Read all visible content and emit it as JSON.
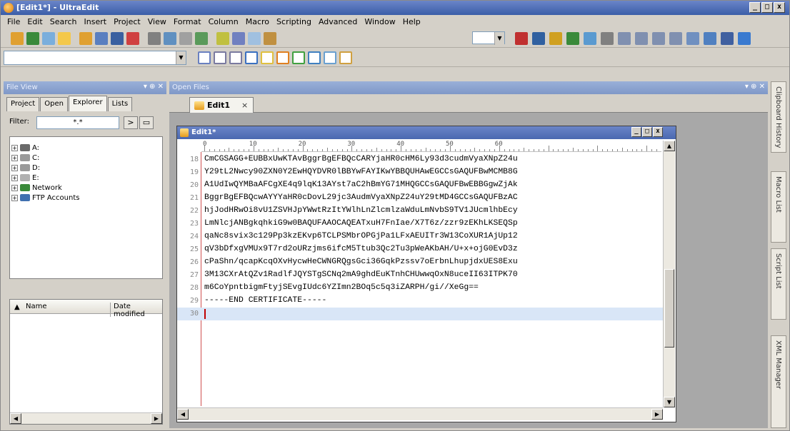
{
  "window": {
    "title": "[Edit1*] - UltraEdit"
  },
  "menu": [
    "File",
    "Edit",
    "Search",
    "Insert",
    "Project",
    "View",
    "Format",
    "Column",
    "Macro",
    "Scripting",
    "Advanced",
    "Window",
    "Help"
  ],
  "left_panel": {
    "title": "File View",
    "tabs": [
      "Project",
      "Open",
      "Explorer",
      "Lists"
    ],
    "active_tab": "Explorer",
    "filter_label": "Filter:",
    "filter_value": "*.*",
    "tree": [
      {
        "label": "A:",
        "icon": "floppy-drive-icon"
      },
      {
        "label": "C:",
        "icon": "hard-drive-icon"
      },
      {
        "label": "D:",
        "icon": "hard-drive-icon"
      },
      {
        "label": "E:",
        "icon": "cd-drive-icon"
      },
      {
        "label": "Network",
        "icon": "network-icon"
      },
      {
        "label": "FTP Accounts",
        "icon": "ftp-accounts-icon"
      }
    ],
    "list_headers": [
      "Name",
      "Date modified"
    ]
  },
  "open_files": {
    "title": "Open Files",
    "tab_label": "Edit1",
    "tab_close": "×"
  },
  "editor": {
    "title": "Edit1*",
    "ruler_marks": [
      "0",
      "10",
      "20",
      "30",
      "40",
      "50",
      "60"
    ],
    "lines": [
      {
        "n": "18",
        "text": "CmCGSAGG+EUBBxUwKTAvBggrBgEFBQcCARYjaHR0cHM6Ly93d3cudmVyaXNpZ24u"
      },
      {
        "n": "19",
        "text": "Y29tL2Nwcy90ZXN0Y2EwHQYDVR0lBBYwFAYIKwYBBQUHAwEGCCsGAQUFBwMCMB8G"
      },
      {
        "n": "20",
        "text": "A1UdIwQYMBaAFCgXE4q9lqK13AYst7aC2hBmYG71MHQGCCsGAQUFBwEBBGgwZjAk"
      },
      {
        "n": "21",
        "text": "BggrBgEFBQcwAYYYaHR0cDovL29jc3AudmVyaXNpZ24uY29tMD4GCCsGAQUFBzAC"
      },
      {
        "n": "22",
        "text": "hjJodHRwOi8vU1ZSVHJpYWwtRzItYWlhLnZlcmlzaWduLmNvbS9TV1JUcmlhbEcy"
      },
      {
        "n": "23",
        "text": "LmNlcjANBgkqhkiG9w0BAQUFAAOCAQEATxuH7FnIae/X7T6z/zzr9zEKhLKSEQSp"
      },
      {
        "n": "24",
        "text": "qaNc8svix3c129Pp3kzEKvp6TCLPSMbrOPGjPa1LFxAEUITr3W13CoXUR1AjUp12"
      },
      {
        "n": "25",
        "text": "qV3bDfxgVMUx9T7rd2oURzjms6ifcM5Ttub3Qc2Tu3pWeAKbAH/U+x+ojG0EvD3z"
      },
      {
        "n": "26",
        "text": "cPaShn/qcapKcqOXvHycwHeCWNGRQgsGci36GqkPzssv7oErbnLhupjdxUES8Exu"
      },
      {
        "n": "27",
        "text": "3M13CXrAtQZv1RadlfJQYSTgSCNq2mA9ghdEuKTnhCHUwwqOxN8uceII63ITPK70"
      },
      {
        "n": "28",
        "text": "m6CoYpntbigmFtyjSEvgIUdc6YZImn2BOq5c5q3iZARPH/gi//XeGg=="
      },
      {
        "n": "29",
        "text": "-----END CERTIFICATE-----"
      },
      {
        "n": "30",
        "text": ""
      }
    ]
  },
  "right_tabs": [
    "Clipboard History",
    "Macro List",
    "Script List",
    "XML Manager"
  ],
  "colors": {
    "titlebar": "#3b5ea8",
    "current_line": "#d9e6f7",
    "caret": "#c00000"
  }
}
